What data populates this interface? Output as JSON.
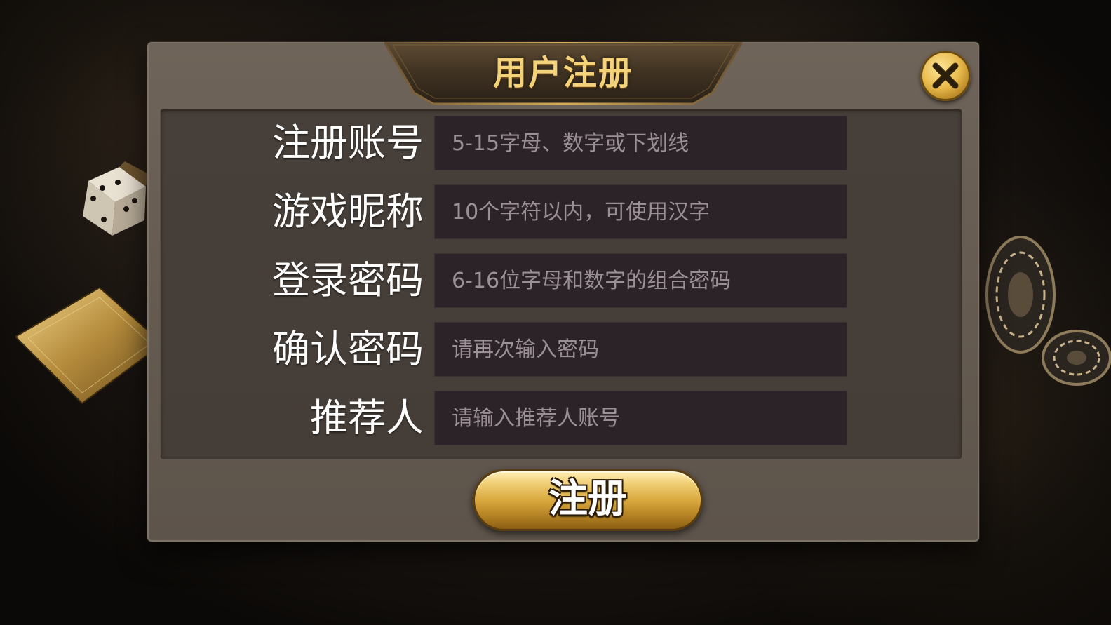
{
  "dialog": {
    "title": "用户注册",
    "close_icon": "close-icon"
  },
  "form": {
    "fields": [
      {
        "label": "注册账号",
        "placeholder": "5-15字母、数字或下划线"
      },
      {
        "label": "游戏昵称",
        "placeholder": "10个字符以内，可使用汉字"
      },
      {
        "label": "登录密码",
        "placeholder": "6-16位字母和数字的组合密码"
      },
      {
        "label": "确认密码",
        "placeholder": "请再次输入密码"
      },
      {
        "label": "推荐人",
        "placeholder": "请输入推荐人账号"
      }
    ]
  },
  "submit": {
    "label": "注册"
  },
  "decor": {
    "icons": [
      "dice-icon",
      "playing-card-icon",
      "casino-chips-icon"
    ]
  },
  "colors": {
    "accent_gold": "#e7b94a",
    "title_gold": "#f4d27a",
    "panel": "#655b51",
    "input_bg": "#2c2329"
  }
}
